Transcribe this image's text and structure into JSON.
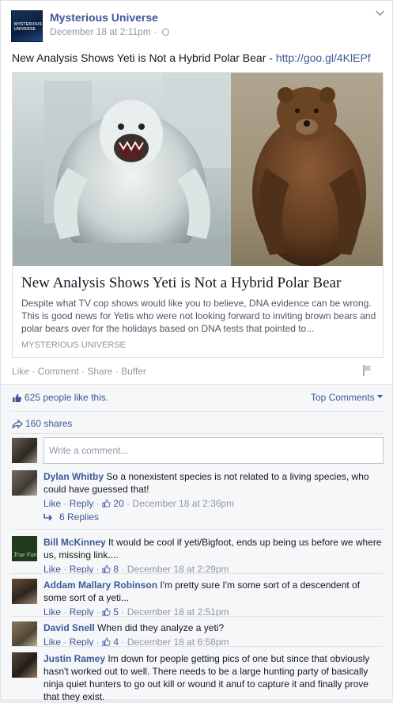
{
  "post": {
    "page_name": "Mysterious Universe",
    "avatar_text": "MYSTERIOUS UNIVERSE",
    "timestamp": "December 18 at 2:11pm",
    "meta_sep": "·",
    "text": "New Analysis Shows Yeti is Not a Hybrid Polar Bear - ",
    "link": "http://goo.gl/4KlEPf"
  },
  "attachment": {
    "title": "New Analysis Shows Yeti is Not a Hybrid Polar Bear",
    "description": "Despite what TV cop shows would like you to believe, DNA evidence can be wrong. This is good news for Yetis who were not looking forward to inviting brown bears and polar bears over for the holidays based on DNA tests that pointed to...",
    "source": "MYSTERIOUS UNIVERSE"
  },
  "actions": {
    "like": "Like",
    "comment": "Comment",
    "share": "Share",
    "buffer": "Buffer",
    "sep": " · "
  },
  "ufi": {
    "likes": "625 people like this.",
    "top_comments": "Top Comments",
    "shares": "160 shares",
    "composer_placeholder": "Write a comment..."
  },
  "comments": [
    {
      "author": "Dylan Whitby",
      "text": "So a nonexistent species is not related to a living species, who could have guessed that!",
      "like": "Like",
      "reply": "Reply",
      "likes": "20",
      "time": "December 18 at 2:36pm"
    },
    {
      "author": "Bill McKinney",
      "text": "It would be cool if yeti/Bigfoot, ends up being us before we where us, missing link....",
      "like": "Like",
      "reply": "Reply",
      "likes": "8",
      "time": "December 18 at 2:29pm"
    },
    {
      "author": "Addam Mallary Robinson",
      "text": "I'm pretty sure I'm some sort of a descendent of some sort of a yeti...",
      "like": "Like",
      "reply": "Reply",
      "likes": "5",
      "time": "December 18 at 2:51pm"
    },
    {
      "author": "David Snell",
      "text": "When did they analyze a yeti?",
      "like": "Like",
      "reply": "Reply",
      "likes": "4",
      "time": "December 18 at 6:58pm"
    },
    {
      "author": "Justin Ramey",
      "text": "Im down for people getting pics of one but since that obviously hasn't worked out to well. There needs to be a large hunting party of basically ninja quiet hunters to go out kill or wound it anuf to capture it and finally prove that they exist."
    }
  ],
  "replies_link": "6 Replies",
  "avatar2_text": "True Fan",
  "icons": [
    "chevron-down-icon",
    "globe-icon",
    "flag-icon",
    "thumbs-up-icon",
    "share-arrow-icon",
    "reply-arrow-icon",
    "caret-down-icon"
  ]
}
